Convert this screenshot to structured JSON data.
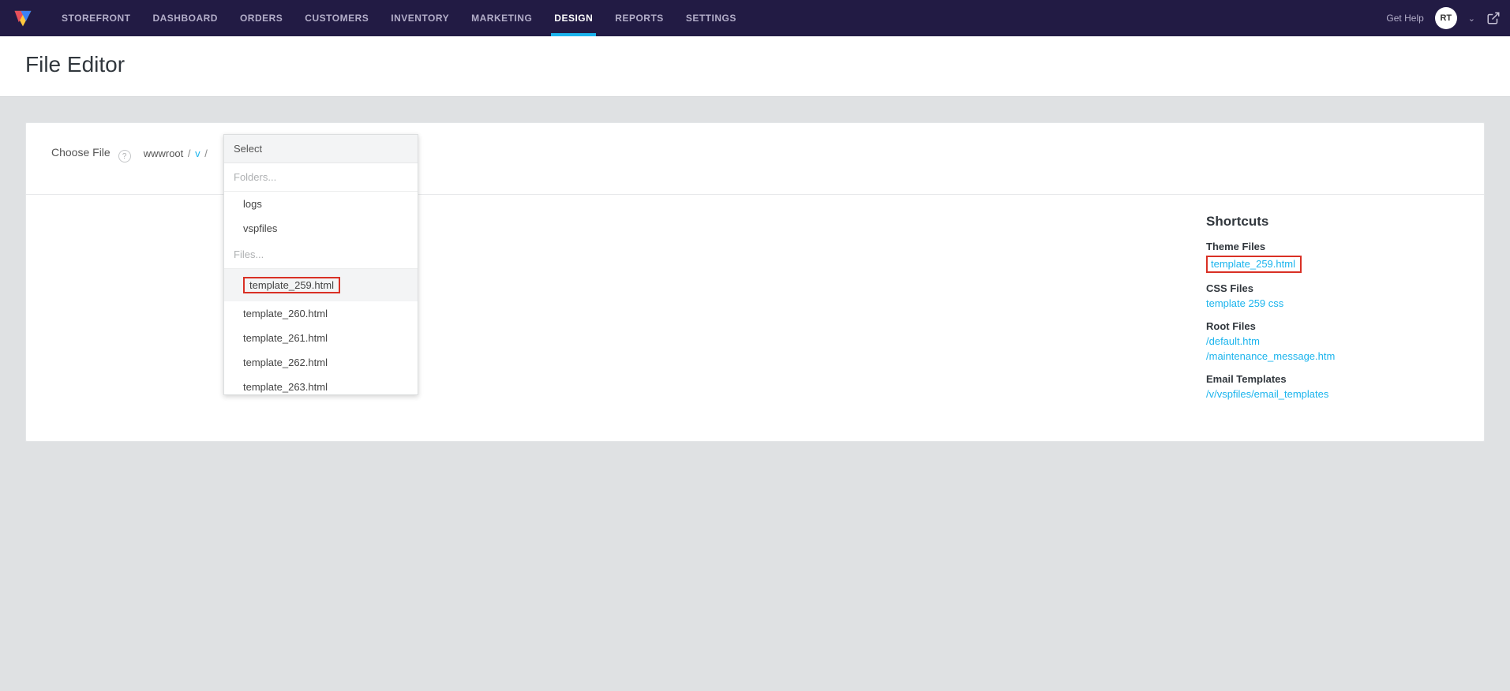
{
  "nav": {
    "items": [
      "STOREFRONT",
      "DASHBOARD",
      "ORDERS",
      "CUSTOMERS",
      "INVENTORY",
      "MARKETING",
      "DESIGN",
      "REPORTS",
      "SETTINGS"
    ],
    "active_index": 6,
    "get_help": "Get Help",
    "avatar_initials": "RT"
  },
  "page": {
    "title": "File Editor"
  },
  "choose": {
    "label": "Choose File",
    "breadcrumb_root": "wwwroot",
    "breadcrumb_link": "v",
    "sep": "/"
  },
  "dropdown": {
    "header": "Select",
    "folders_label": "Folders...",
    "folders": [
      "logs",
      "vspfiles"
    ],
    "files_label": "Files...",
    "files": [
      "template_259.html",
      "template_260.html",
      "template_261.html",
      "template_262.html",
      "template_263.html"
    ],
    "highlight_index": 0
  },
  "shortcuts": {
    "title": "Shortcuts",
    "theme_label": "Theme Files",
    "theme_link": "template_259.html",
    "css_label": "CSS Files",
    "css_link": "template 259 css",
    "root_label": "Root Files",
    "root_links": [
      "/default.htm",
      "/maintenance_message.htm"
    ],
    "email_label": "Email Templates",
    "email_link": "/v/vspfiles/email_templates"
  }
}
